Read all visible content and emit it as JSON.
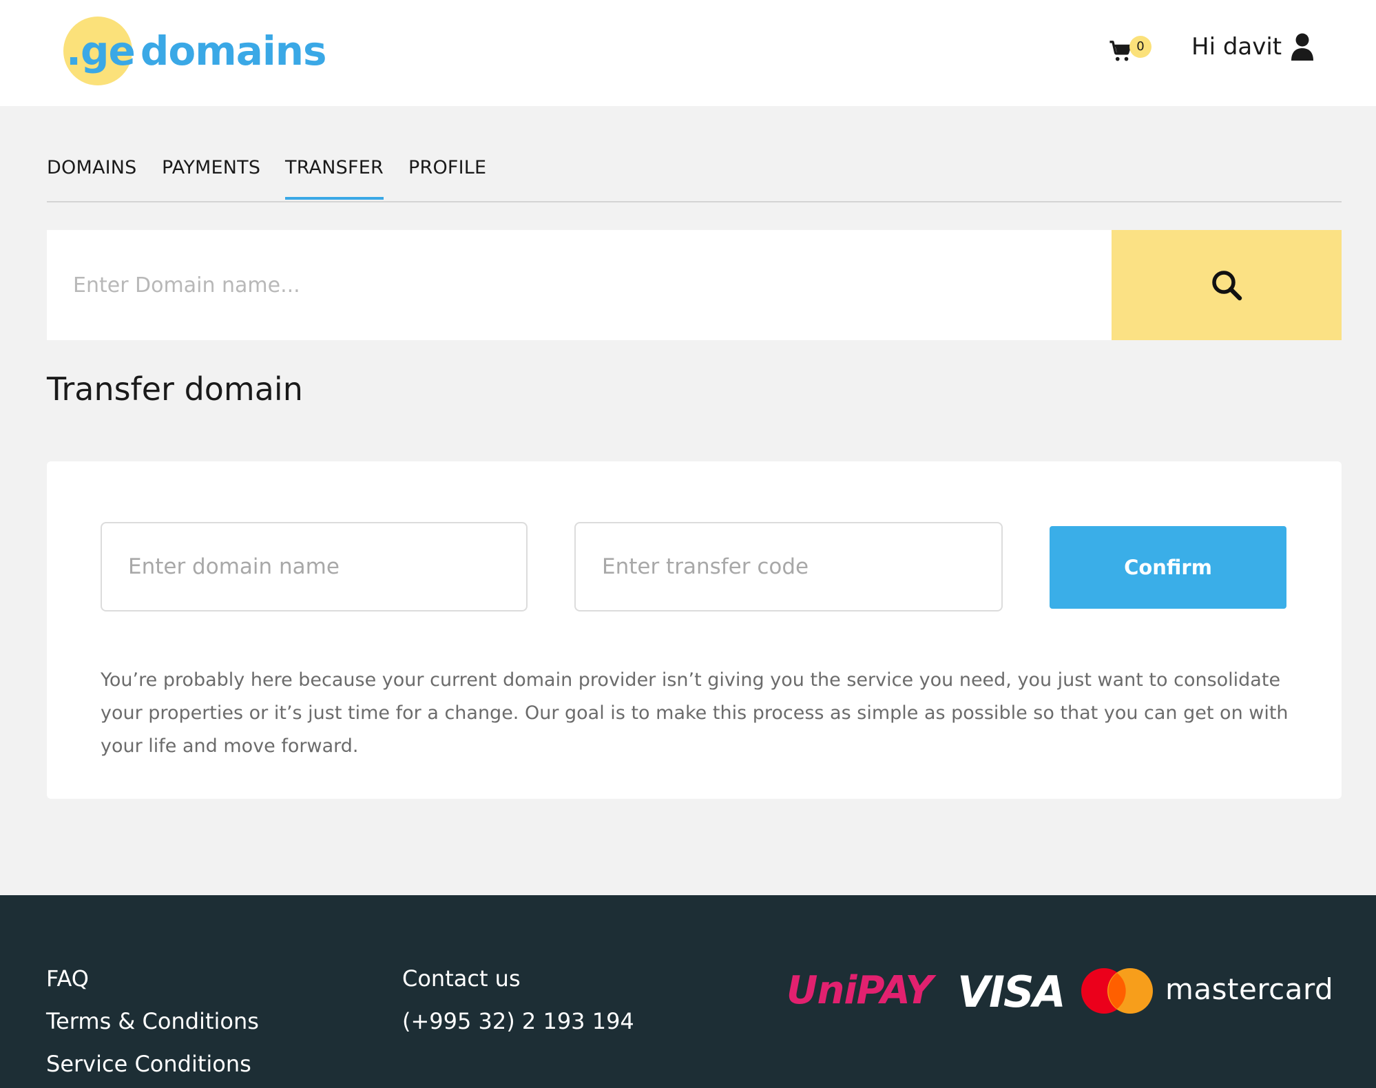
{
  "header": {
    "logo_prefix": ".ge",
    "logo_name": "domains",
    "cart_count": "0",
    "greeting": "Hi davit"
  },
  "tabs": [
    {
      "label": "DOMAINS",
      "active": false
    },
    {
      "label": "PAYMENTS",
      "active": false
    },
    {
      "label": "TRANSFER",
      "active": true
    },
    {
      "label": "PROFILE",
      "active": false
    }
  ],
  "search": {
    "placeholder": "Enter Domain name..."
  },
  "transfer": {
    "title": "Transfer domain",
    "domain_placeholder": "Enter domain name",
    "code_placeholder": "Enter transfer code",
    "confirm_label": "Confirm",
    "description": "You’re probably here because your current domain provider isn’t giving you the service you need, you just want to consolidate your properties or it’s just time for a change. Our goal is to make this process as simple as possible so that you can get on with your life and move forward."
  },
  "footer": {
    "links_col1": [
      "FAQ",
      "Terms & Conditions",
      "Service Conditions"
    ],
    "contact_label": "Contact us",
    "phone": "(+995 32) 2 193 194",
    "payments": {
      "unipay": "UniPAY",
      "visa": "VISA",
      "mastercard": "mastercard"
    }
  },
  "colors": {
    "accent_blue": "#3aaee8",
    "accent_yellow": "#fbe184",
    "footer_bg": "#1d2e35",
    "unipay_pink": "#e2216f"
  },
  "icons": [
    "cart-icon",
    "user-icon",
    "search-icon",
    "mastercard-logo"
  ]
}
